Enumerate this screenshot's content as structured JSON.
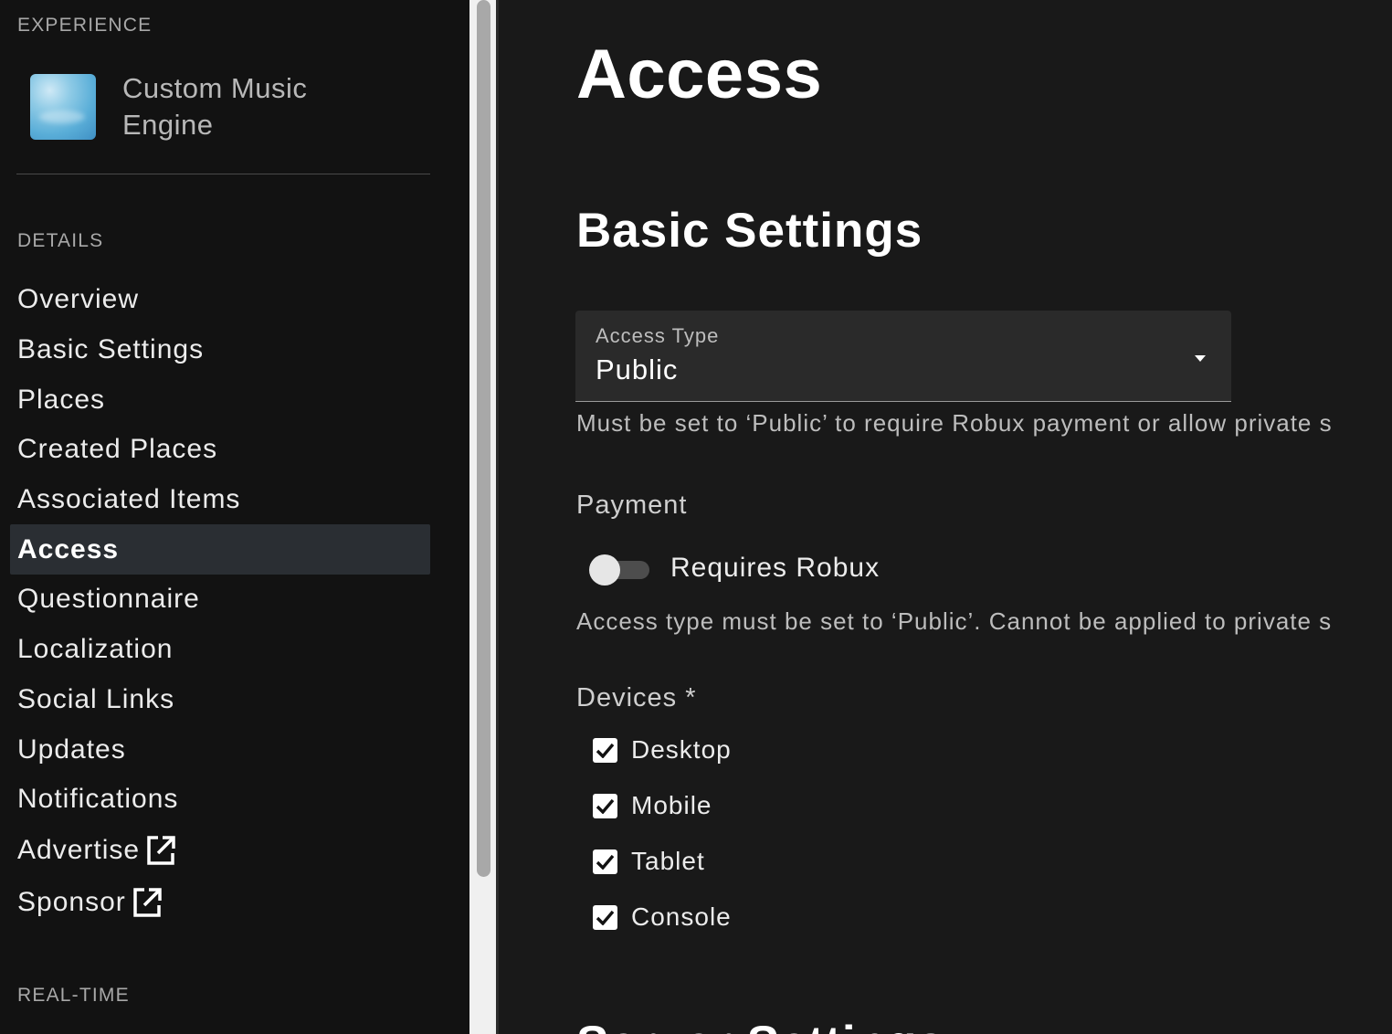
{
  "sidebar": {
    "experience_heading": "EXPERIENCE",
    "experience_name": "Custom Music Engine",
    "details_heading": "DETAILS",
    "items": [
      {
        "label": "Overview",
        "active": false
      },
      {
        "label": "Basic Settings",
        "active": false
      },
      {
        "label": "Places",
        "active": false
      },
      {
        "label": "Created Places",
        "active": false
      },
      {
        "label": "Associated Items",
        "active": false
      },
      {
        "label": "Access",
        "active": true
      },
      {
        "label": "Questionnaire",
        "active": false
      },
      {
        "label": "Localization",
        "active": false
      },
      {
        "label": "Social Links",
        "active": false
      },
      {
        "label": "Updates",
        "active": false
      },
      {
        "label": "Notifications",
        "active": false
      },
      {
        "label": "Advertise",
        "active": false,
        "external": true
      },
      {
        "label": "Sponsor",
        "active": false,
        "external": true
      }
    ],
    "realtime_heading": "REAL-TIME"
  },
  "main": {
    "page_title": "Access",
    "section_title": "Basic Settings",
    "access_type": {
      "label": "Access Type",
      "value": "Public",
      "helper": "Must be set to ‘Public’ to require Robux payment or allow private s"
    },
    "payment": {
      "label": "Payment",
      "toggle_label": "Requires Robux",
      "toggle_on": false,
      "helper": "Access type must be set to ‘Public’. Cannot be applied to private s"
    },
    "devices": {
      "label": "Devices *",
      "options": [
        {
          "label": "Desktop",
          "checked": true
        },
        {
          "label": "Mobile",
          "checked": true
        },
        {
          "label": "Tablet",
          "checked": true
        },
        {
          "label": "Console",
          "checked": true
        }
      ]
    },
    "next_section_partial": "Server Settings"
  },
  "icons": {
    "external_link": "external-link-icon",
    "dropdown": "caret-down-icon",
    "check": "checkmark-icon"
  },
  "colors": {
    "background": "#191919",
    "sidebar_bg": "#121212",
    "active_item_bg": "#2a2e33",
    "field_bg": "#2a2a2a"
  }
}
